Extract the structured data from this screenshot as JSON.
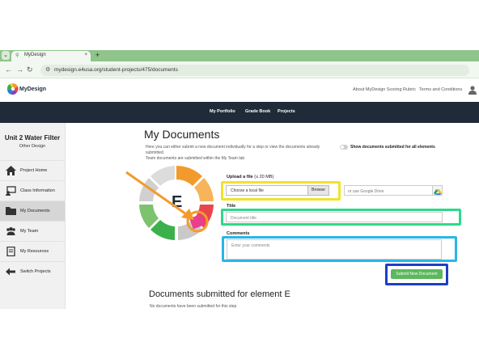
{
  "browser": {
    "tab_title": "MyDesign",
    "tab_close": "×",
    "new_tab": "+",
    "url": "mydesign.e4usa.org/student-projects/475/documents",
    "back": "←",
    "forward": "→",
    "reload": "↻"
  },
  "header": {
    "logo_text": "MyDesign",
    "links": [
      "About MyDesign Scoring Rubric",
      "Terms and Conditions"
    ]
  },
  "nav": {
    "items": [
      "My Portfolio",
      "Grade Book",
      "Projects"
    ]
  },
  "sidebar": {
    "title": "Unit 2 Water Filter",
    "subtitle": "Other Design",
    "items": [
      {
        "label": "Project Home",
        "icon": "home-icon"
      },
      {
        "label": "Class Information",
        "icon": "class-info-icon"
      },
      {
        "label": "My Documents",
        "icon": "folder-icon",
        "active": true
      },
      {
        "label": "My Team",
        "icon": "team-icon"
      },
      {
        "label": "My Resources",
        "icon": "resources-icon"
      },
      {
        "label": "Switch Projects",
        "icon": "switch-arrow-icon"
      }
    ]
  },
  "main": {
    "title": "My Documents",
    "description_1": "Here you can either submit a new document individually for a step or view the documents already submitted.",
    "description_2": "Team documents are submitted within the My Team tab",
    "toggle_label": "Show documents submitted for all elements",
    "wheel_letter": "E",
    "upload_label": "Upload a file",
    "upload_limit": "(≤ 20 MB)",
    "file_text": "Choose a local file",
    "browse_label": "Browse",
    "gdrive_text": "or use Google Drive",
    "title_label": "Title",
    "title_placeholder": "Document title",
    "comments_label": "Comments",
    "comments_placeholder": "Enter your comments",
    "submit_label": "Submit New Document",
    "section_title": "Documents submitted for element E",
    "section_empty": "No documents have been submitted for this step"
  },
  "colors": {
    "navbar": "#1f2b38",
    "submit": "#5cb85c",
    "highlight_file": "#f2e22a",
    "highlight_title": "#2ed88a",
    "highlight_comments": "#29b6e6",
    "highlight_submit": "#1d3fc4",
    "annotation_arrow": "#f39a2c"
  }
}
